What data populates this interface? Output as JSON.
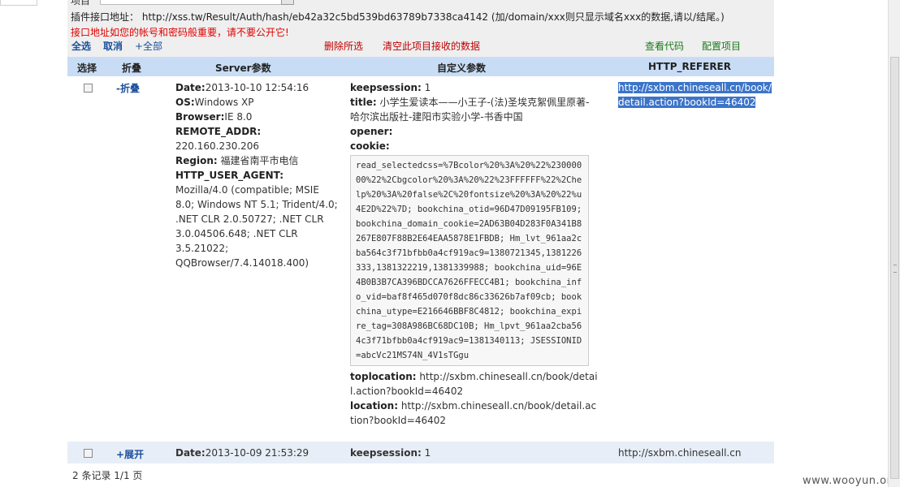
{
  "top": {
    "label_cut": "项目",
    "interface_url_label": "插件接口地址：",
    "interface_url": "http://xss.tw/Result/Auth/hash/eb42a32c5bd539bd63789b7338ca4142",
    "interface_hint": "(加/domain/xxx则只显示域名xxx的数据,请以/结尾。)",
    "warning": "接口地址如您的帐号和密码般重要，请不要公开它!",
    "select_all": "全选",
    "cancel": "取消",
    "expand_all": "+全部",
    "delete_selected": "删除所选",
    "clear_data": "清空此项目接收的数据",
    "view_code": "查看代码",
    "config_project": "配置项目"
  },
  "table": {
    "headers": [
      "选择",
      "折叠",
      "Server参数",
      "自定义参数",
      "HTTP_REFERER"
    ],
    "rows": [
      {
        "toggle": "-折叠",
        "server": {
          "date_k": "Date:",
          "date_v": "2013-10-10 12:54:16",
          "os_k": "OS:",
          "os_v": "Windows XP",
          "browser_k": "Browser:",
          "browser_v": "IE 8.0",
          "addr_k": "REMOTE_ADDR:",
          "addr_v": "220.160.230.206",
          "region_k": "Region:",
          "region_v": " 福建省南平市电信",
          "ua_k": "HTTP_USER_AGENT:",
          "ua_v": " Mozilla/4.0 (compatible; MSIE 8.0; Windows NT 5.1; Trident/4.0; .NET CLR 2.0.50727; .NET CLR 3.0.04506.648; .NET CLR 3.5.21022; QQBrowser/7.4.14018.400)"
        },
        "custom": {
          "keepsession_k": "keepsession:",
          "keepsession_v": "1",
          "title_k": "title:",
          "title_v": "小学生爱读本——小王子-(法)圣埃克絮佩里原著-哈尔滨出版社-建阳市实验小学-书香中国",
          "opener_k": "opener:",
          "cookie_k": "cookie:",
          "cookie_v": "read_selectedcss=%7Bcolor%20%3A%20%22%23000000%22%2Cbgcolor%20%3A%20%22%23FFFFFF%22%2Chelp%20%3A%20false%2C%20fontsize%20%3A%20%22%u4E2D%22%7D; bookchina_otid=96D47D09195FB109; bookchina_domain_cookie=2AD63B04D283F0A341B8267E807F88B2E64EAA5878E1FBDB; Hm_lvt_961aa2cba564c3f71bfbb0a4cf919ac9=1380721345,1381226333,1381322219,1381339988; bookchina_uid=96E4B0B3B7CA396BDCCA7626FFECC4B1; bookchina_info_vid=baf8f465d070f8dc86c33626b7af09cb; bookchina_utype=E216646BBF8C4812; bookchina_expire_tag=308A986BC68DC10B; Hm_lpvt_961aa2cba564c3f71bfbb0a4cf919ac9=1381340113; JSESSIONID=abcVc21MS74N_4V1sTGgu",
          "toplocation_k": "toplocation:",
          "toplocation_v": "http://sxbm.chineseall.cn/book/detail.action?bookId=46402",
          "location_k": "location:",
          "location_v": "http://sxbm.chineseall.cn/book/detail.action?bookId=46402"
        },
        "referer": "http://sxbm.chineseall.cn/book/detail.action?bookId=46402"
      },
      {
        "toggle": "+展开",
        "server": {
          "date_k": "Date:",
          "date_v": "2013-10-09 21:53:29"
        },
        "custom": {
          "keepsession_k": "keepsession:",
          "keepsession_v": "1"
        },
        "referer": "http://sxbm.chineseall.cn"
      }
    ]
  },
  "footer": "2 条记录 1/1 页",
  "watermark": "www.wooyun.org"
}
